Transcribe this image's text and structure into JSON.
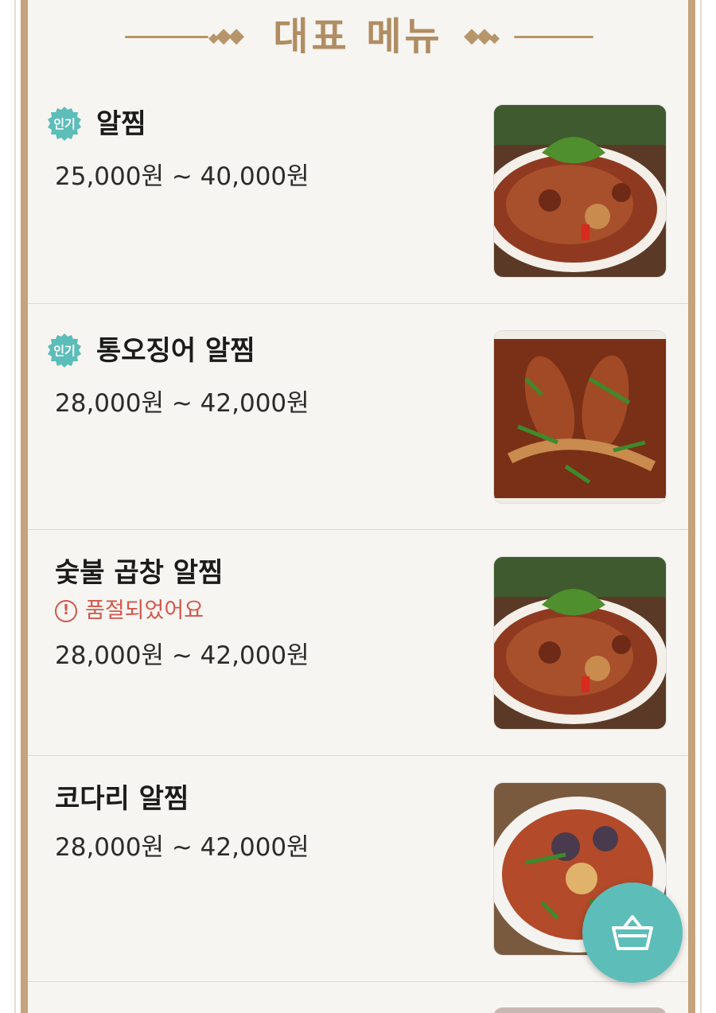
{
  "header": {
    "title": "대표 메뉴"
  },
  "menu": {
    "items": [
      {
        "name": "알찜",
        "price": "25,000원 ~ 40,000원",
        "badge": "인기",
        "status": ""
      },
      {
        "name": "통오징어 알찜",
        "price": "28,000원 ~ 42,000원",
        "badge": "인기",
        "status": ""
      },
      {
        "name": "숯불 곱창 알찜",
        "price": "28,000원 ~ 42,000원",
        "badge": "",
        "status": "품절되었어요"
      },
      {
        "name": "코다리 알찜",
        "price": "28,000원 ~ 42,000원",
        "badge": "",
        "status": ""
      }
    ]
  },
  "icons": {
    "alert": "alert-circle-icon",
    "cart": "shopping-basket-icon"
  },
  "colors": {
    "accent_gold": "#b08d62",
    "badge_teal": "#5cbdb9",
    "cart_teal": "#5cbdb9",
    "soldout_red": "#d1574c"
  }
}
